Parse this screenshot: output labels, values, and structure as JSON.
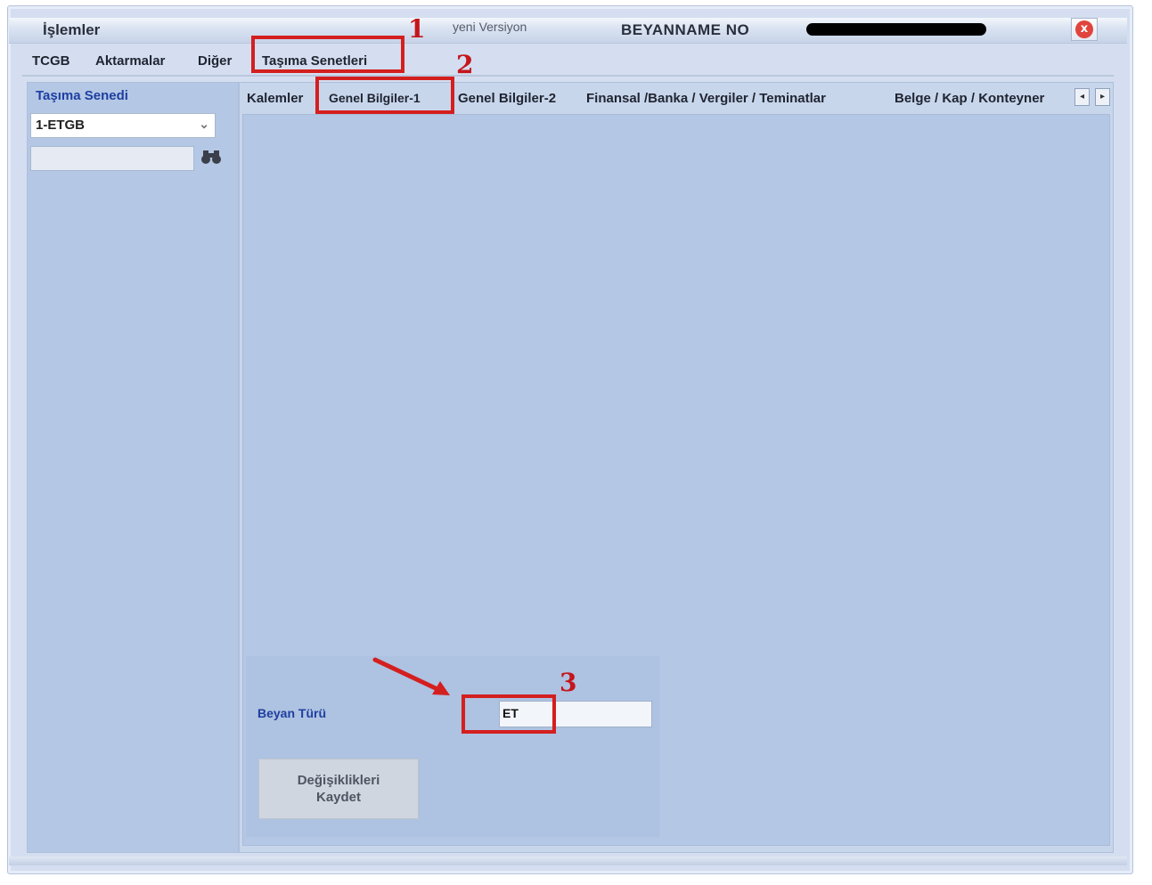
{
  "window": {
    "title": "İşlemler",
    "version": "yeni Versiyon",
    "declaration_no_label": "BEYANNAME NO",
    "close_icon": "x"
  },
  "top_tabs": [
    "TCGB",
    "Aktarmalar",
    "Diğer",
    "Taşıma Senetleri"
  ],
  "left_panel": {
    "title": "Taşıma Senedi",
    "selected": "1-ETGB",
    "dropdown_icon": "⌄",
    "search_icon": "binoculars"
  },
  "sub_tabs": [
    "Kalemler",
    "Genel Bilgiler-1",
    "Genel Bilgiler-2",
    "Finansal /Banka / Vergiler / Teminatlar",
    "Belge / Kap / Konteyner"
  ],
  "scroll": {
    "left": "◂",
    "right": "▸"
  },
  "form": {
    "beyan_label": "Beyan Türü",
    "beyan_value": "ET",
    "save_line1": "Değişiklikleri",
    "save_line2": "Kaydet"
  },
  "annotations": {
    "n1": "1",
    "n2": "2",
    "n3": "3",
    "color": "#d41f1f"
  }
}
